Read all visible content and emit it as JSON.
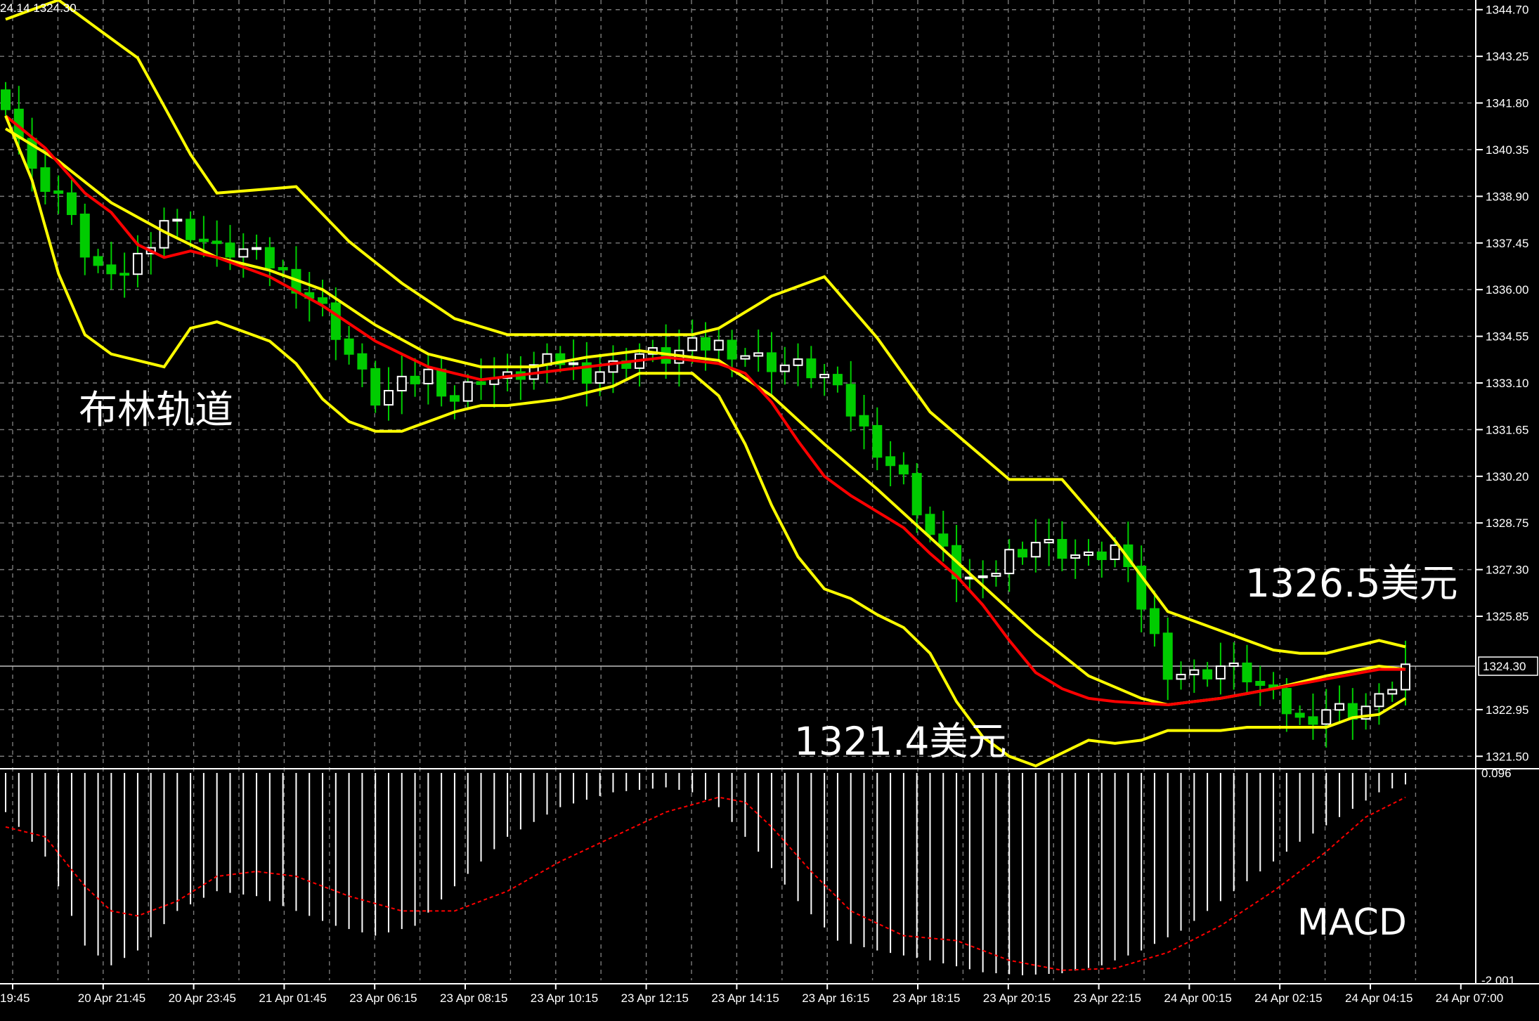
{
  "header": {
    "readout": "24.14 1324.30"
  },
  "annotations": {
    "bollinger": "布林轨道",
    "high_level": "1326.5美元",
    "low_level": "1321.4美元",
    "macd": "MACD"
  },
  "colors": {
    "background": "#000000",
    "grid": "#7a7a7a",
    "axis": "#ffffff",
    "bull_candle": "#ffffff",
    "bear_candle": "#00cc00",
    "bollinger_band": "#ffff00",
    "ma_line": "#ff0000",
    "macd_hist": "#ffffff",
    "macd_signal": "#ff0000",
    "current_price_line": "#c0c0c0"
  },
  "chart_data": [
    {
      "type": "line",
      "name": "price-panel",
      "y_range": [
        1321.2,
        1345.0
      ],
      "price_labels": [
        "1344.70",
        "1343.25",
        "1341.80",
        "1340.35",
        "1338.90",
        "1337.45",
        "1336.00",
        "1334.55",
        "1333.10",
        "1331.65",
        "1330.20",
        "1328.75",
        "1327.30",
        "1325.85",
        "1322.95",
        "1321.50"
      ],
      "current_price": "1324.30",
      "time_labels": [
        "19:45",
        "20 Apr 21:45",
        "20 Apr 23:45",
        "21 Apr 01:45",
        "23 Apr 06:15",
        "23 Apr 08:15",
        "23 Apr 10:15",
        "23 Apr 12:15",
        "23 Apr 14:15",
        "23 Apr 16:15",
        "23 Apr 18:15",
        "23 Apr 20:15",
        "23 Apr 22:15",
        "24 Apr 00:15",
        "24 Apr 02:15",
        "24 Apr 04:15",
        "24 Apr 07:00"
      ],
      "x_count": 107,
      "close_anchors": [
        [
          0,
          1341.9
        ],
        [
          2,
          1339.6
        ],
        [
          4,
          1339.0
        ],
        [
          6,
          1337.2
        ],
        [
          8,
          1336.2
        ],
        [
          10,
          1337.0
        ],
        [
          12,
          1338.2
        ],
        [
          14,
          1337.8
        ],
        [
          16,
          1337.2
        ],
        [
          18,
          1337.2
        ],
        [
          20,
          1336.8
        ],
        [
          22,
          1336.2
        ],
        [
          24,
          1335.4
        ],
        [
          26,
          1334.0
        ],
        [
          28,
          1332.6
        ],
        [
          30,
          1333.0
        ],
        [
          32,
          1333.4
        ],
        [
          34,
          1332.6
        ],
        [
          36,
          1333.3
        ],
        [
          38,
          1333.2
        ],
        [
          40,
          1333.6
        ],
        [
          42,
          1333.8
        ],
        [
          44,
          1333.4
        ],
        [
          46,
          1333.6
        ],
        [
          48,
          1334.0
        ],
        [
          50,
          1333.9
        ],
        [
          52,
          1334.2
        ],
        [
          54,
          1334.3
        ],
        [
          56,
          1334.0
        ],
        [
          58,
          1333.7
        ],
        [
          60,
          1333.6
        ],
        [
          62,
          1333.3
        ],
        [
          64,
          1332.2
        ],
        [
          66,
          1331.1
        ],
        [
          68,
          1330.1
        ],
        [
          70,
          1328.4
        ],
        [
          72,
          1327.2
        ],
        [
          74,
          1326.8
        ],
        [
          76,
          1327.8
        ],
        [
          78,
          1328.2
        ],
        [
          80,
          1327.9
        ],
        [
          82,
          1327.6
        ],
        [
          84,
          1328.0
        ],
        [
          86,
          1326.2
        ],
        [
          88,
          1324.2
        ],
        [
          90,
          1324.0
        ],
        [
          92,
          1324.3
        ],
        [
          94,
          1324.0
        ],
        [
          96,
          1323.3
        ],
        [
          98,
          1322.6
        ],
        [
          100,
          1323.0
        ],
        [
          102,
          1322.9
        ],
        [
          104,
          1323.2
        ],
        [
          106,
          1324.3
        ]
      ],
      "series": [
        {
          "name": "bollinger-upper",
          "anchors": [
            [
              0,
              1344.4
            ],
            [
              4,
              1345.0
            ],
            [
              10,
              1343.2
            ],
            [
              14,
              1340.2
            ],
            [
              16,
              1339.0
            ],
            [
              22,
              1339.2
            ],
            [
              26,
              1337.5
            ],
            [
              30,
              1336.2
            ],
            [
              34,
              1335.1
            ],
            [
              38,
              1334.6
            ],
            [
              46,
              1334.6
            ],
            [
              52,
              1334.6
            ],
            [
              54,
              1334.8
            ],
            [
              58,
              1335.8
            ],
            [
              62,
              1336.4
            ],
            [
              66,
              1334.5
            ],
            [
              70,
              1332.2
            ],
            [
              72,
              1331.5
            ],
            [
              76,
              1330.1
            ],
            [
              80,
              1330.1
            ],
            [
              84,
              1328.2
            ],
            [
              88,
              1326.0
            ],
            [
              92,
              1325.4
            ],
            [
              96,
              1324.8
            ],
            [
              98,
              1324.7
            ],
            [
              100,
              1324.7
            ],
            [
              102,
              1324.9
            ],
            [
              104,
              1325.1
            ],
            [
              106,
              1324.9
            ]
          ]
        },
        {
          "name": "bollinger-middle",
          "anchors": [
            [
              0,
              1341.0
            ],
            [
              4,
              1340.0
            ],
            [
              8,
              1338.7
            ],
            [
              12,
              1337.8
            ],
            [
              16,
              1337.0
            ],
            [
              20,
              1336.6
            ],
            [
              24,
              1336.0
            ],
            [
              28,
              1334.9
            ],
            [
              32,
              1334.0
            ],
            [
              36,
              1333.6
            ],
            [
              40,
              1333.6
            ],
            [
              44,
              1333.9
            ],
            [
              48,
              1334.1
            ],
            [
              52,
              1333.9
            ],
            [
              54,
              1333.8
            ],
            [
              58,
              1332.7
            ],
            [
              62,
              1331.2
            ],
            [
              66,
              1329.8
            ],
            [
              70,
              1328.3
            ],
            [
              74,
              1326.8
            ],
            [
              78,
              1325.3
            ],
            [
              82,
              1324.0
            ],
            [
              86,
              1323.3
            ],
            [
              88,
              1323.1
            ],
            [
              92,
              1323.3
            ],
            [
              96,
              1323.6
            ],
            [
              100,
              1324.0
            ],
            [
              104,
              1324.3
            ],
            [
              106,
              1324.2
            ]
          ]
        },
        {
          "name": "ma-red",
          "anchors": [
            [
              0,
              1341.4
            ],
            [
              3,
              1340.4
            ],
            [
              6,
              1339.0
            ],
            [
              8,
              1338.4
            ],
            [
              10,
              1337.4
            ],
            [
              12,
              1337.0
            ],
            [
              14,
              1337.2
            ],
            [
              16,
              1337.0
            ],
            [
              20,
              1336.4
            ],
            [
              24,
              1335.5
            ],
            [
              28,
              1334.4
            ],
            [
              32,
              1333.6
            ],
            [
              36,
              1333.2
            ],
            [
              40,
              1333.4
            ],
            [
              44,
              1333.6
            ],
            [
              48,
              1333.8
            ],
            [
              50,
              1333.9
            ],
            [
              52,
              1333.8
            ],
            [
              54,
              1333.7
            ],
            [
              56,
              1333.4
            ],
            [
              58,
              1332.5
            ],
            [
              60,
              1331.3
            ],
            [
              62,
              1330.2
            ],
            [
              64,
              1329.6
            ],
            [
              66,
              1329.1
            ],
            [
              68,
              1328.6
            ],
            [
              70,
              1327.8
            ],
            [
              72,
              1327.1
            ],
            [
              74,
              1326.2
            ],
            [
              76,
              1325.1
            ],
            [
              78,
              1324.1
            ],
            [
              80,
              1323.6
            ],
            [
              82,
              1323.3
            ],
            [
              84,
              1323.2
            ],
            [
              88,
              1323.1
            ],
            [
              92,
              1323.3
            ],
            [
              96,
              1323.6
            ],
            [
              100,
              1323.9
            ],
            [
              104,
              1324.2
            ],
            [
              106,
              1324.2
            ]
          ]
        },
        {
          "name": "bollinger-lower",
          "anchors": [
            [
              0,
              1341.4
            ],
            [
              2,
              1339.4
            ],
            [
              4,
              1336.5
            ],
            [
              6,
              1334.6
            ],
            [
              8,
              1334.0
            ],
            [
              10,
              1333.8
            ],
            [
              12,
              1333.6
            ],
            [
              14,
              1334.8
            ],
            [
              16,
              1335.0
            ],
            [
              20,
              1334.4
            ],
            [
              22,
              1333.7
            ],
            [
              24,
              1332.6
            ],
            [
              26,
              1331.9
            ],
            [
              28,
              1331.6
            ],
            [
              30,
              1331.6
            ],
            [
              32,
              1331.9
            ],
            [
              34,
              1332.2
            ],
            [
              36,
              1332.4
            ],
            [
              38,
              1332.4
            ],
            [
              42,
              1332.6
            ],
            [
              46,
              1333.0
            ],
            [
              48,
              1333.4
            ],
            [
              50,
              1333.4
            ],
            [
              52,
              1333.4
            ],
            [
              54,
              1332.7
            ],
            [
              56,
              1331.2
            ],
            [
              58,
              1329.3
            ],
            [
              60,
              1327.7
            ],
            [
              62,
              1326.7
            ],
            [
              64,
              1326.4
            ],
            [
              66,
              1325.9
            ],
            [
              68,
              1325.5
            ],
            [
              70,
              1324.7
            ],
            [
              72,
              1323.2
            ],
            [
              74,
              1322.1
            ],
            [
              76,
              1321.5
            ],
            [
              78,
              1321.2
            ],
            [
              80,
              1321.6
            ],
            [
              82,
              1322.0
            ],
            [
              84,
              1321.9
            ],
            [
              86,
              1322.0
            ],
            [
              88,
              1322.3
            ],
            [
              90,
              1322.3
            ],
            [
              92,
              1322.3
            ],
            [
              94,
              1322.4
            ],
            [
              96,
              1322.4
            ],
            [
              98,
              1322.4
            ],
            [
              100,
              1322.4
            ],
            [
              102,
              1322.7
            ],
            [
              104,
              1322.8
            ],
            [
              106,
              1323.3
            ]
          ]
        }
      ]
    },
    {
      "type": "bar",
      "name": "macd-panel",
      "y_range": [
        -2.001,
        0.096
      ],
      "y_labels": [
        "0.096",
        "-2.001"
      ],
      "hist_anchors": [
        [
          0,
          -0.3
        ],
        [
          3,
          -0.75
        ],
        [
          6,
          -1.65
        ],
        [
          8,
          -1.85
        ],
        [
          10,
          -1.7
        ],
        [
          13,
          -1.3
        ],
        [
          16,
          -1.1
        ],
        [
          19,
          -1.15
        ],
        [
          22,
          -1.3
        ],
        [
          25,
          -1.45
        ],
        [
          28,
          -1.55
        ],
        [
          31,
          -1.45
        ],
        [
          34,
          -1.05
        ],
        [
          38,
          -0.55
        ],
        [
          42,
          -0.25
        ],
        [
          46,
          -0.1
        ],
        [
          50,
          -0.05
        ],
        [
          52,
          -0.1
        ],
        [
          54,
          -0.25
        ],
        [
          57,
          -0.7
        ],
        [
          60,
          -1.2
        ],
        [
          63,
          -1.6
        ],
        [
          66,
          -1.7
        ],
        [
          70,
          -1.8
        ],
        [
          74,
          -1.92
        ],
        [
          77,
          -1.95
        ],
        [
          80,
          -1.93
        ],
        [
          83,
          -1.85
        ],
        [
          86,
          -1.7
        ],
        [
          89,
          -1.5
        ],
        [
          92,
          -1.2
        ],
        [
          95,
          -0.9
        ],
        [
          98,
          -0.6
        ],
        [
          101,
          -0.35
        ],
        [
          104,
          -0.1
        ],
        [
          106,
          -0.02
        ]
      ],
      "signal_anchors": [
        [
          0,
          -0.45
        ],
        [
          3,
          -0.55
        ],
        [
          6,
          -1.05
        ],
        [
          8,
          -1.3
        ],
        [
          10,
          -1.35
        ],
        [
          13,
          -1.2
        ],
        [
          16,
          -0.95
        ],
        [
          19,
          -0.9
        ],
        [
          22,
          -0.95
        ],
        [
          26,
          -1.15
        ],
        [
          30,
          -1.3
        ],
        [
          34,
          -1.3
        ],
        [
          38,
          -1.1
        ],
        [
          42,
          -0.8
        ],
        [
          46,
          -0.55
        ],
        [
          50,
          -0.3
        ],
        [
          54,
          -0.15
        ],
        [
          56,
          -0.2
        ],
        [
          58,
          -0.45
        ],
        [
          61,
          -0.9
        ],
        [
          64,
          -1.3
        ],
        [
          68,
          -1.55
        ],
        [
          72,
          -1.6
        ],
        [
          76,
          -1.8
        ],
        [
          80,
          -1.9
        ],
        [
          84,
          -1.88
        ],
        [
          88,
          -1.72
        ],
        [
          92,
          -1.45
        ],
        [
          96,
          -1.1
        ],
        [
          100,
          -0.7
        ],
        [
          103,
          -0.35
        ],
        [
          106,
          -0.15
        ]
      ]
    }
  ]
}
